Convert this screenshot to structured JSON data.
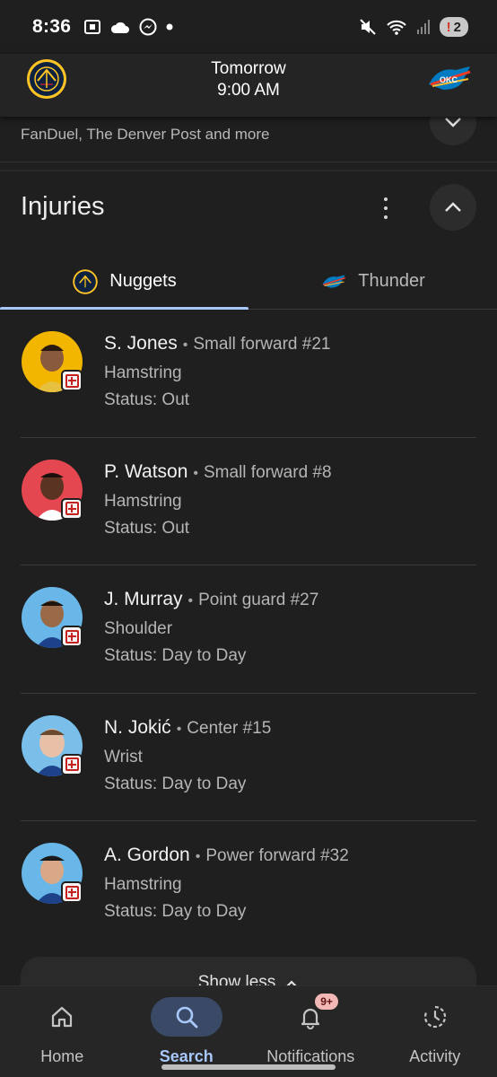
{
  "status_bar": {
    "time": "8:36",
    "battery_count": "2",
    "battery_warn": "!"
  },
  "header": {
    "game_day": "Tomorrow",
    "game_time": "9:00 AM",
    "home_team_logo": "nuggets-logo",
    "away_team_logo": "thunder-logo"
  },
  "sources": {
    "text": "FanDuel, The Denver Post and more"
  },
  "injuries": {
    "title": "Injuries",
    "tabs": [
      {
        "label": "Nuggets",
        "active": true
      },
      {
        "label": "Thunder",
        "active": false
      }
    ],
    "players": [
      {
        "name": "S. Jones",
        "position": "Small forward #21",
        "injury": "Hamstring",
        "status": "Status: Out",
        "avatar_bg": "#f2b500"
      },
      {
        "name": "P. Watson",
        "position": "Small forward #8",
        "injury": "Hamstring",
        "status": "Status: Out",
        "avatar_bg": "#e4474f"
      },
      {
        "name": "J. Murray",
        "position": "Point guard #27",
        "injury": "Shoulder",
        "status": "Status: Day to Day",
        "avatar_bg": "#69b7e8"
      },
      {
        "name": "N. Jokić",
        "position": "Center #15",
        "injury": "Wrist",
        "status": "Status: Day to Day",
        "avatar_bg": "#79bfe9"
      },
      {
        "name": "A. Gordon",
        "position": "Power forward #32",
        "injury": "Hamstring",
        "status": "Status: Day to Day",
        "avatar_bg": "#69b7e8"
      }
    ],
    "show_less_label": "Show less"
  },
  "bottom_nav": {
    "items": [
      {
        "label": "Home",
        "icon": "home-icon",
        "active": false
      },
      {
        "label": "Search",
        "icon": "search-icon",
        "active": true
      },
      {
        "label": "Notifications",
        "icon": "bell-icon",
        "active": false,
        "badge": "9+"
      },
      {
        "label": "Activity",
        "icon": "activity-icon",
        "active": false
      }
    ]
  },
  "colors": {
    "background": "#1f1f1f",
    "accent": "#a8c7fa",
    "injury_red": "#c5221f"
  }
}
